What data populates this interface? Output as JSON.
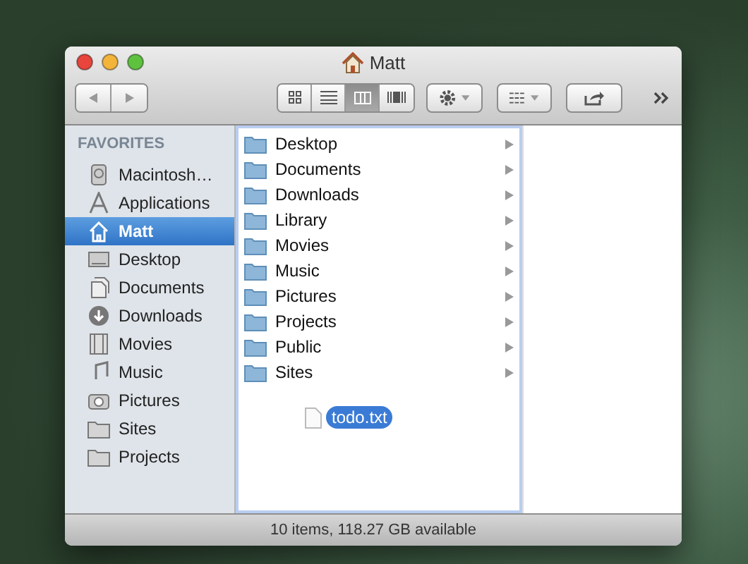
{
  "window": {
    "title": "Matt"
  },
  "toolbar": {
    "view_buttons": [
      {
        "selected": false
      },
      {
        "selected": false
      },
      {
        "selected": true
      },
      {
        "selected": false
      }
    ]
  },
  "sidebar": {
    "heading": "FAVORITES",
    "items": [
      {
        "label": "Macintosh…",
        "selected": false
      },
      {
        "label": "Applications",
        "selected": false
      },
      {
        "label": "Matt",
        "selected": true
      },
      {
        "label": "Desktop",
        "selected": false
      },
      {
        "label": "Documents",
        "selected": false
      },
      {
        "label": "Downloads",
        "selected": false
      },
      {
        "label": "Movies",
        "selected": false
      },
      {
        "label": "Music",
        "selected": false
      },
      {
        "label": "Pictures",
        "selected": false
      },
      {
        "label": "Sites",
        "selected": false
      },
      {
        "label": "Projects",
        "selected": false
      }
    ]
  },
  "column_1": {
    "folders": [
      {
        "label": "Desktop"
      },
      {
        "label": "Documents"
      },
      {
        "label": "Downloads"
      },
      {
        "label": "Library"
      },
      {
        "label": "Movies"
      },
      {
        "label": "Music"
      },
      {
        "label": "Pictures"
      },
      {
        "label": "Projects"
      },
      {
        "label": "Public"
      },
      {
        "label": "Sites"
      }
    ],
    "files": [
      {
        "label": "todo.txt",
        "selected": true
      }
    ]
  },
  "status_bar": "10 items, 118.27 GB available"
}
